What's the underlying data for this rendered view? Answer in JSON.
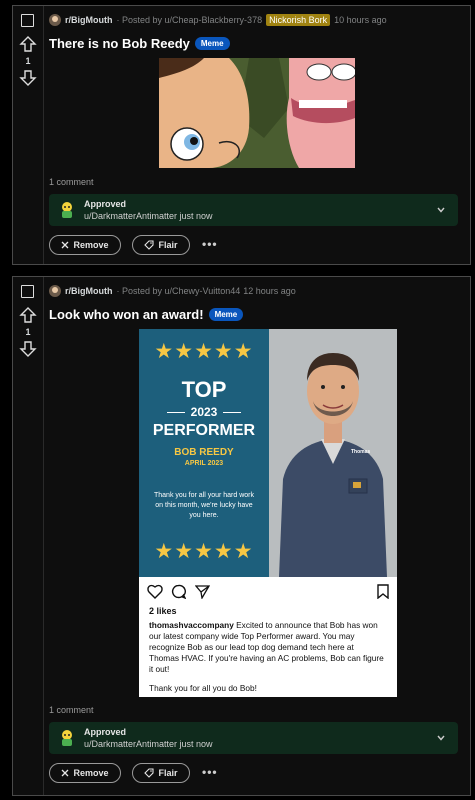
{
  "posts": [
    {
      "subreddit": "r/BigMouth",
      "posted_by": "· Posted by u/Cheap-Blackberry-378",
      "user_flair": "Nickorish Bork",
      "time": "10 hours ago",
      "score": "1",
      "title": "There is no Bob Reedy",
      "tag": "Meme",
      "comments": "1 comment",
      "approved_label": "Approved",
      "approved_by": "u/DarkmatterAntimatter just now",
      "remove_label": "Remove",
      "flair_label": "Flair",
      "more_label": "•••"
    },
    {
      "subreddit": "r/BigMouth",
      "posted_by": "· Posted by u/Chewy-Vuitton44",
      "time": "12 hours ago",
      "score": "1",
      "title": "Look who won an award!",
      "tag": "Meme",
      "comments": "1 comment",
      "approved_label": "Approved",
      "approved_by": "u/DarkmatterAntimatter just now",
      "remove_label": "Remove",
      "flair_label": "Flair",
      "more_label": "•••"
    }
  ],
  "award": {
    "stars": "★★★★★",
    "top": "TOP",
    "year": "2023",
    "performer": "PERFORMER",
    "name": "BOB REEDY",
    "month": "APRIL 2023",
    "thanks": "Thank you for all your hard work on this month, we're lucky have you here.",
    "logo_text": "Thomas"
  },
  "instagram": {
    "likes": "2 likes",
    "account": "thomashvaccompany",
    "caption": " Excited to announce that Bob has won our latest company wide Top Performer award. You may recognize Bob as our lead top dog demand tech here at Thomas HVAC. If you're having an AC problems, Bob can figure it out!",
    "caption2": "Thank you for all you do Bob!"
  },
  "colors": {
    "background": "#000000",
    "post_bg": "#0e0e0e",
    "approved_bg": "#0f2a1c",
    "meme_tag": "#0a56bc",
    "user_flair": "#a08311",
    "award_blue": "#1d5f7c",
    "star": "#f6c744"
  },
  "icons": [
    "checkbox-icon",
    "upvote-icon",
    "downvote-icon",
    "subreddit-avatar-icon",
    "mod-avatar-icon",
    "chevron-down-icon",
    "close-icon",
    "tag-icon",
    "heart-icon",
    "comment-icon",
    "send-icon",
    "bookmark-icon"
  ]
}
